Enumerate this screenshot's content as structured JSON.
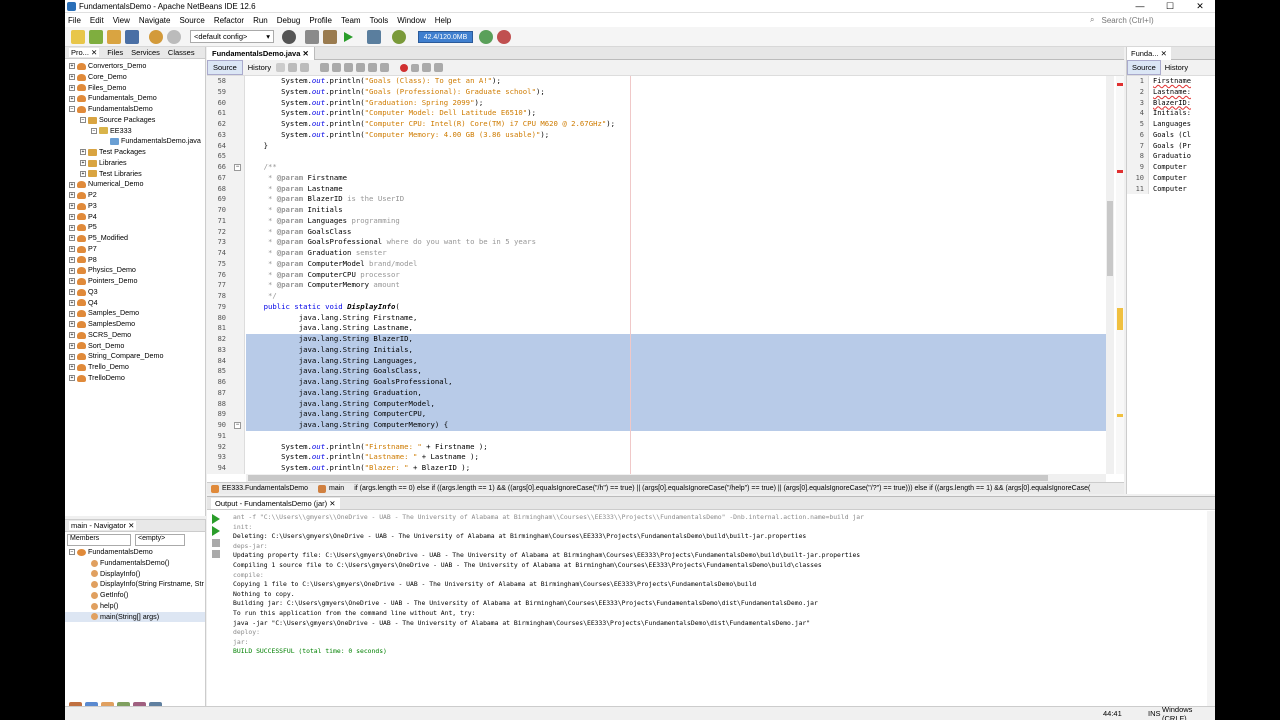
{
  "window": {
    "title": "FundamentalsDemo - Apache NetBeans IDE 12.6",
    "minimize": "—",
    "maximize": "☐",
    "close": "✕"
  },
  "menu": [
    "File",
    "Edit",
    "View",
    "Navigate",
    "Source",
    "Refactor",
    "Run",
    "Debug",
    "Profile",
    "Team",
    "Tools",
    "Window",
    "Help"
  ],
  "search_placeholder": "Search (Ctrl+I)",
  "toolbar": {
    "config": "<default config>",
    "memory": "42.4/120.0MB"
  },
  "projects": {
    "tabs": [
      "Pro... ✕",
      "Files",
      "Services",
      "Classes"
    ],
    "items": [
      {
        "label": "Convertors_Demo",
        "level": 0,
        "toggle": "+"
      },
      {
        "label": "Core_Demo",
        "level": 0,
        "toggle": "+"
      },
      {
        "label": "Files_Demo",
        "level": 0,
        "toggle": "+"
      },
      {
        "label": "Fundamentals_Demo",
        "level": 0,
        "toggle": "+"
      },
      {
        "label": "FundamentalsDemo",
        "level": 0,
        "toggle": "−"
      },
      {
        "label": "Source Packages",
        "level": 1,
        "toggle": "−"
      },
      {
        "label": "EE333",
        "level": 2,
        "toggle": "−"
      },
      {
        "label": "FundamentalsDemo.java",
        "level": 3,
        "toggle": ""
      },
      {
        "label": "Test Packages",
        "level": 1,
        "toggle": "+"
      },
      {
        "label": "Libraries",
        "level": 1,
        "toggle": "+"
      },
      {
        "label": "Test Libraries",
        "level": 1,
        "toggle": "+"
      },
      {
        "label": "Numerical_Demo",
        "level": 0,
        "toggle": "+"
      },
      {
        "label": "P2",
        "level": 0,
        "toggle": "+"
      },
      {
        "label": "P3",
        "level": 0,
        "toggle": "+"
      },
      {
        "label": "P4",
        "level": 0,
        "toggle": "+"
      },
      {
        "label": "P5",
        "level": 0,
        "toggle": "+"
      },
      {
        "label": "P5_Modified",
        "level": 0,
        "toggle": "+"
      },
      {
        "label": "P7",
        "level": 0,
        "toggle": "+"
      },
      {
        "label": "P8",
        "level": 0,
        "toggle": "+"
      },
      {
        "label": "Physics_Demo",
        "level": 0,
        "toggle": "+"
      },
      {
        "label": "Pointers_Demo",
        "level": 0,
        "toggle": "+"
      },
      {
        "label": "Q3",
        "level": 0,
        "toggle": "+"
      },
      {
        "label": "Q4",
        "level": 0,
        "toggle": "+"
      },
      {
        "label": "Samples_Demo",
        "level": 0,
        "toggle": "+"
      },
      {
        "label": "SamplesDemo",
        "level": 0,
        "toggle": "+"
      },
      {
        "label": "SCRS_Demo",
        "level": 0,
        "toggle": "+"
      },
      {
        "label": "Sort_Demo",
        "level": 0,
        "toggle": "+"
      },
      {
        "label": "String_Compare_Demo",
        "level": 0,
        "toggle": "+"
      },
      {
        "label": "Trello_Demo",
        "level": 0,
        "toggle": "+"
      },
      {
        "label": "TrelloDemo",
        "level": 0,
        "toggle": "+"
      }
    ]
  },
  "navigator": {
    "tab": "main - Navigator ✕",
    "filter_label": "Members",
    "filter_value": "<empty>",
    "root": "FundamentalsDemo",
    "members": [
      "FundamentalsDemo()",
      "DisplayInfo()",
      "DisplayInfo(String Firstname, Str",
      "GetInfo()",
      "help()",
      "main(String[] args)"
    ]
  },
  "editor": {
    "tab": "FundamentalsDemo.java ✕",
    "mode_source": "Source",
    "mode_history": "History",
    "lines": [
      {
        "n": "58",
        "parts": [
          [
            "        System.",
            "p"
          ],
          [
            "out",
            "f"
          ],
          [
            ".println(",
            "p"
          ],
          [
            "\"Goals (Class): To get an A!\"",
            "s"
          ],
          [
            ");",
            "p"
          ]
        ],
        "sel": false
      },
      {
        "n": "59",
        "parts": [
          [
            "        System.",
            "p"
          ],
          [
            "out",
            "f"
          ],
          [
            ".println(",
            "p"
          ],
          [
            "\"Goals (Professional): Graduate school\"",
            "s"
          ],
          [
            ");",
            "p"
          ]
        ],
        "sel": false
      },
      {
        "n": "60",
        "parts": [
          [
            "        System.",
            "p"
          ],
          [
            "out",
            "f"
          ],
          [
            ".println(",
            "p"
          ],
          [
            "\"Graduation: Spring 2099\"",
            "s"
          ],
          [
            ");",
            "p"
          ]
        ],
        "sel": false
      },
      {
        "n": "61",
        "parts": [
          [
            "        System.",
            "p"
          ],
          [
            "out",
            "f"
          ],
          [
            ".println(",
            "p"
          ],
          [
            "\"Computer Model: Dell Latitude E6510\"",
            "s"
          ],
          [
            ");",
            "p"
          ]
        ],
        "sel": false
      },
      {
        "n": "62",
        "parts": [
          [
            "        System.",
            "p"
          ],
          [
            "out",
            "f"
          ],
          [
            ".println(",
            "p"
          ],
          [
            "\"Computer CPU: Intel(R) Core(TM) i7 CPU M620 @ 2.67GHz\"",
            "s"
          ],
          [
            ");",
            "p"
          ]
        ],
        "sel": false
      },
      {
        "n": "63",
        "parts": [
          [
            "        System.",
            "p"
          ],
          [
            "out",
            "f"
          ],
          [
            ".println(",
            "p"
          ],
          [
            "\"Computer Memory: 4.00 GB (3.86 usable)\"",
            "s"
          ],
          [
            ");",
            "p"
          ]
        ],
        "sel": false
      },
      {
        "n": "64",
        "parts": [
          [
            "    }",
            "p"
          ]
        ],
        "sel": false
      },
      {
        "n": "65",
        "parts": [
          [
            "",
            "p"
          ]
        ],
        "sel": false
      },
      {
        "n": "66",
        "parts": [
          [
            "    /**",
            "c"
          ]
        ],
        "sel": false
      },
      {
        "n": "67",
        "parts": [
          [
            "     * ",
            "c"
          ],
          [
            "@param",
            "t"
          ],
          [
            " Firstname",
            "p"
          ]
        ],
        "sel": false
      },
      {
        "n": "68",
        "parts": [
          [
            "     * ",
            "c"
          ],
          [
            "@param",
            "t"
          ],
          [
            " Lastname",
            "p"
          ]
        ],
        "sel": false
      },
      {
        "n": "69",
        "parts": [
          [
            "     * ",
            "c"
          ],
          [
            "@param",
            "t"
          ],
          [
            " BlazerID",
            "p"
          ],
          [
            " is the UserID",
            "c"
          ]
        ],
        "sel": false
      },
      {
        "n": "70",
        "parts": [
          [
            "     * ",
            "c"
          ],
          [
            "@param",
            "t"
          ],
          [
            " Initials",
            "p"
          ]
        ],
        "sel": false
      },
      {
        "n": "71",
        "parts": [
          [
            "     * ",
            "c"
          ],
          [
            "@param",
            "t"
          ],
          [
            " Languages",
            "p"
          ],
          [
            " programming",
            "c"
          ]
        ],
        "sel": false
      },
      {
        "n": "72",
        "parts": [
          [
            "     * ",
            "c"
          ],
          [
            "@param",
            "t"
          ],
          [
            " GoalsClass",
            "p"
          ]
        ],
        "sel": false
      },
      {
        "n": "73",
        "parts": [
          [
            "     * ",
            "c"
          ],
          [
            "@param",
            "t"
          ],
          [
            " GoalsProfessional",
            "p"
          ],
          [
            " where do you want to be in 5 years",
            "c"
          ]
        ],
        "sel": false
      },
      {
        "n": "74",
        "parts": [
          [
            "     * ",
            "c"
          ],
          [
            "@param",
            "t"
          ],
          [
            " Graduation",
            "p"
          ],
          [
            " semster",
            "c"
          ]
        ],
        "sel": false
      },
      {
        "n": "75",
        "parts": [
          [
            "     * ",
            "c"
          ],
          [
            "@param",
            "t"
          ],
          [
            " ComputerModel",
            "p"
          ],
          [
            " brand/model",
            "c"
          ]
        ],
        "sel": false
      },
      {
        "n": "76",
        "parts": [
          [
            "     * ",
            "c"
          ],
          [
            "@param",
            "t"
          ],
          [
            " ComputerCPU",
            "p"
          ],
          [
            " processor",
            "c"
          ]
        ],
        "sel": false
      },
      {
        "n": "77",
        "parts": [
          [
            "     * ",
            "c"
          ],
          [
            "@param",
            "t"
          ],
          [
            " ComputerMemory",
            "p"
          ],
          [
            " amount",
            "c"
          ]
        ],
        "sel": false
      },
      {
        "n": "78",
        "parts": [
          [
            "     */",
            "c"
          ]
        ],
        "sel": false
      },
      {
        "n": "79",
        "parts": [
          [
            "    ",
            "p"
          ],
          [
            "public static void",
            "k"
          ],
          [
            " ",
            "p"
          ],
          [
            "DisplayInfo",
            "m"
          ],
          [
            "(",
            "p"
          ]
        ],
        "sel": false
      },
      {
        "n": "80",
        "parts": [
          [
            "            java.lang.String Firstname,",
            "p"
          ]
        ],
        "sel": false
      },
      {
        "n": "81",
        "parts": [
          [
            "            java.lang.String Lastname,",
            "p"
          ]
        ],
        "sel": false
      },
      {
        "n": "82",
        "parts": [
          [
            "            java.lang.String BlazerID,",
            "p"
          ]
        ],
        "sel": true
      },
      {
        "n": "83",
        "parts": [
          [
            "            java.lang.String Initials,",
            "p"
          ]
        ],
        "sel": true
      },
      {
        "n": "84",
        "parts": [
          [
            "            java.lang.String Languages,",
            "p"
          ]
        ],
        "sel": true
      },
      {
        "n": "85",
        "parts": [
          [
            "            java.lang.String GoalsClass,",
            "p"
          ]
        ],
        "sel": true
      },
      {
        "n": "86",
        "parts": [
          [
            "            java.lang.String GoalsProfessional,",
            "p"
          ]
        ],
        "sel": true
      },
      {
        "n": "87",
        "parts": [
          [
            "            java.lang.String Graduation,",
            "p"
          ]
        ],
        "sel": true
      },
      {
        "n": "88",
        "parts": [
          [
            "            java.lang.String ComputerModel,",
            "p"
          ]
        ],
        "sel": true
      },
      {
        "n": "89",
        "parts": [
          [
            "            java.lang.String ComputerCPU,",
            "p"
          ]
        ],
        "sel": true
      },
      {
        "n": "90",
        "parts": [
          [
            "            java.lang.String ComputerMemory) {",
            "p"
          ]
        ],
        "sel": true
      },
      {
        "n": "91",
        "parts": [
          [
            "",
            "p"
          ]
        ],
        "sel": false
      },
      {
        "n": "92",
        "parts": [
          [
            "        System.",
            "p"
          ],
          [
            "out",
            "f"
          ],
          [
            ".println(",
            "p"
          ],
          [
            "\"Firstname: \"",
            "s"
          ],
          [
            " + Firstname );",
            "p"
          ]
        ],
        "sel": false
      },
      {
        "n": "93",
        "parts": [
          [
            "        System.",
            "p"
          ],
          [
            "out",
            "f"
          ],
          [
            ".println(",
            "p"
          ],
          [
            "\"Lastname: \"",
            "s"
          ],
          [
            " + Lastname );",
            "p"
          ]
        ],
        "sel": false
      },
      {
        "n": "94",
        "parts": [
          [
            "        System.",
            "p"
          ],
          [
            "out",
            "f"
          ],
          [
            ".println(",
            "p"
          ],
          [
            "\"Blazer: \"",
            "s"
          ],
          [
            " + BlazerID );",
            "p"
          ]
        ],
        "sel": false
      }
    ],
    "status_class": "EE333.FundamentalsDemo",
    "status_method": "main",
    "status_path": "if (args.length == 0) else if ((args.length == 1) && ((args[0].equalsIgnoreCase(\"/h\") == true) || (args[0].equalsIgnoreCase(\"/help\") == true) || (args[0].equalsIgnoreCase(\"/?\") == true))) else if ((args.length == 1) && (args[0].equalsIgnoreCase("
  },
  "rightpanel": {
    "tab": "Funda... ✕",
    "mode_source": "Source",
    "mode_history": "History",
    "lines": [
      {
        "n": "1",
        "t": "Firstname"
      },
      {
        "n": "2",
        "t": "Lastname:"
      },
      {
        "n": "3",
        "t": "BlazerID:"
      },
      {
        "n": "4",
        "t": "Initials:"
      },
      {
        "n": "5",
        "t": "Languages"
      },
      {
        "n": "6",
        "t": "Goals (Cl"
      },
      {
        "n": "7",
        "t": "Goals (Pr"
      },
      {
        "n": "8",
        "t": "Graduatio"
      },
      {
        "n": "9",
        "t": "Computer"
      },
      {
        "n": "10",
        "t": "Computer"
      },
      {
        "n": "11",
        "t": "Computer"
      }
    ]
  },
  "output": {
    "tab": "Output - FundamentalsDemo (jar) ✕",
    "lines": [
      {
        "t": "ant -f \"C:\\\\Users\\\\gmyers\\\\OneDrive - UAB - The University of Alabama at Birmingham\\\\Courses\\\\EE333\\\\Projects\\\\FundamentalsDemo\" -Dnb.internal.action.name=build jar",
        "c": "g"
      },
      {
        "t": "init:",
        "c": "g"
      },
      {
        "t": "Deleting: C:\\Users\\gmyers\\OneDrive - UAB - The University of Alabama at Birmingham\\Courses\\EE333\\Projects\\FundamentalsDemo\\build\\built-jar.properties",
        "c": "b"
      },
      {
        "t": "deps-jar:",
        "c": "g"
      },
      {
        "t": "Updating property file: C:\\Users\\gmyers\\OneDrive - UAB - The University of Alabama at Birmingham\\Courses\\EE333\\Projects\\FundamentalsDemo\\build\\built-jar.properties",
        "c": "b"
      },
      {
        "t": "Compiling 1 source file to C:\\Users\\gmyers\\OneDrive - UAB - The University of Alabama at Birmingham\\Courses\\EE333\\Projects\\FundamentalsDemo\\build\\classes",
        "c": "b"
      },
      {
        "t": "compile:",
        "c": "g"
      },
      {
        "t": "Copying 1 file to C:\\Users\\gmyers\\OneDrive - UAB - The University of Alabama at Birmingham\\Courses\\EE333\\Projects\\FundamentalsDemo\\build",
        "c": "b"
      },
      {
        "t": "Nothing to copy.",
        "c": "b"
      },
      {
        "t": "Building jar: C:\\Users\\gmyers\\OneDrive - UAB - The University of Alabama at Birmingham\\Courses\\EE333\\Projects\\FundamentalsDemo\\dist\\FundamentalsDemo.jar",
        "c": "b"
      },
      {
        "t": "To run this application from the command line without Ant, try:",
        "c": "b"
      },
      {
        "t": "java -jar \"C:\\Users\\gmyers\\OneDrive - UAB - The University of Alabama at Birmingham\\Courses\\EE333\\Projects\\FundamentalsDemo\\dist\\FundamentalsDemo.jar\"",
        "c": "b"
      },
      {
        "t": "deploy:",
        "c": "g"
      },
      {
        "t": "jar:",
        "c": "g"
      },
      {
        "t": "BUILD SUCCESSFUL (total time: 0 seconds)",
        "c": "s"
      }
    ]
  },
  "statusbar": {
    "position": "44:41",
    "mode": "INS",
    "eol": "Windows (CRLF)"
  },
  "colors": {
    "selection": "#b8cbe8",
    "keyword": "#0000e6",
    "string": "#ce7b00",
    "comment": "#969696",
    "success": "#008000"
  }
}
